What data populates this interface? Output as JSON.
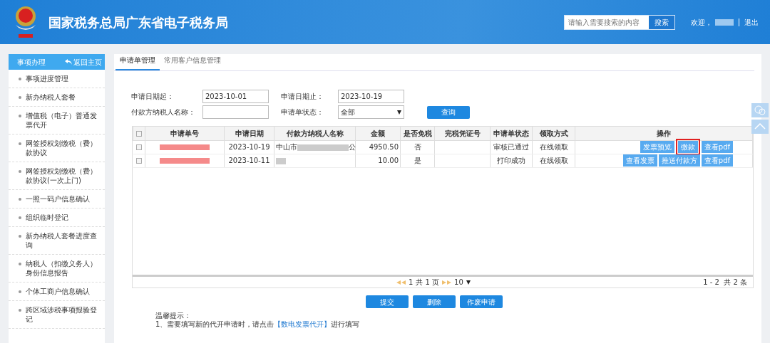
{
  "header": {
    "title": "国家税务总局广东省电子税务局",
    "search_placeholder": "请输入需要搜索的内容",
    "search_button": "搜索",
    "welcome": "欢迎，",
    "logout": "退出"
  },
  "sidebar": {
    "title": "事项办理",
    "back": "返回主页",
    "items": [
      {
        "label": "事项进度管理"
      },
      {
        "label": "新办纳税人套餐"
      },
      {
        "label": "增值税（电子）普通发票代开"
      },
      {
        "label": "网签授权划缴税（费）款协议"
      },
      {
        "label": "网签授权划缴税（费）款协议(一次上门)"
      },
      {
        "label": "一照一码户信息确认"
      },
      {
        "label": "组织临时登记"
      },
      {
        "label": "新办纳税人套餐进度查询"
      },
      {
        "label": "纳税人（扣缴义务人）身份信息报告"
      },
      {
        "label": "个体工商户信息确认"
      },
      {
        "label": "跨区域涉税事项报验登记"
      }
    ]
  },
  "tabs": [
    {
      "label": "申请单管理",
      "selected": true
    },
    {
      "label": "常用客户信息管理",
      "selected": false
    }
  ],
  "filters": {
    "start_label": "申请日期起：",
    "start_value": "2023-10-01",
    "end_label": "申请日期止：",
    "end_value": "2023-10-19",
    "payer_label": "付款方纳税人名称：",
    "status_label": "申请单状态：",
    "status_value": "全部",
    "query_button": "查询"
  },
  "table": {
    "columns": [
      "申请单号",
      "申请日期",
      "付款方纳税人名称",
      "金额",
      "是否免税",
      "完税凭证号",
      "申请单状态",
      "领取方式",
      "操作"
    ],
    "header_checked": false,
    "rows": [
      {
        "checked": false,
        "date": "2023-10-19",
        "payer_prefix": "中山市",
        "payer_suffix": "公",
        "amount": "4950.50",
        "tax_free": "否",
        "status": "审核已通过",
        "method": "在线领取",
        "actions": [
          {
            "label": "发票预览",
            "highlighted": false
          },
          {
            "label": "缴款",
            "highlighted": true
          },
          {
            "label": "查看pdf",
            "highlighted": false
          }
        ]
      },
      {
        "checked": false,
        "date": "2023-10-11",
        "payer_prefix": "",
        "payer_suffix": "",
        "amount": "10.00",
        "tax_free": "是",
        "status": "打印成功",
        "method": "在线领取",
        "actions": [
          {
            "label": "查看发票",
            "highlighted": false
          },
          {
            "label": "推送付款方",
            "highlighted": false
          },
          {
            "label": "查看pdf",
            "highlighted": false
          }
        ]
      }
    ]
  },
  "pager": {
    "page": "1",
    "pages": "共 1 页",
    "page_size": "10",
    "summary": "1 - 2  共 2 条"
  },
  "buttons": [
    "提交",
    "删除",
    "作废申请"
  ],
  "notice": {
    "title": "温馨提示：",
    "lines": [
      {
        "before": "1、需要填写新的代开申请时，请点击",
        "link": "【数电发票代开】",
        "after": "进行填写"
      }
    ]
  }
}
